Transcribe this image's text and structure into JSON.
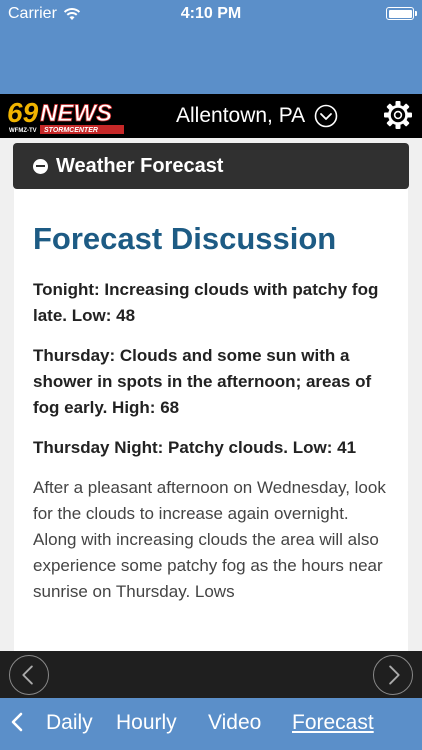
{
  "status_bar": {
    "carrier": "Carrier",
    "time": "4:10 PM"
  },
  "header": {
    "logo_text": "69NEWS",
    "logo_subtext": "WFMZ-TV STORMCENTER",
    "location": "Allentown, PA"
  },
  "section": {
    "title": "Weather Forecast"
  },
  "discussion": {
    "heading": "Forecast Discussion",
    "tonight": "Tonight: Increasing clouds with patchy fog late. Low: 48",
    "thursday": "Thursday: Clouds and some sun with a shower in spots in the afternoon; areas of fog early. High: 68",
    "thursday_night": "Thursday Night: Patchy clouds. Low: 41",
    "body": "After a pleasant afternoon on Wednesday, look for the clouds to increase again overnight. Along with increasing clouds the area will also experience some patchy fog as the hours near sunrise on Thursday. Lows"
  },
  "tabs": {
    "daily": "Daily",
    "hourly": "Hourly",
    "video": "Video",
    "forecast": "Forecast"
  },
  "colors": {
    "bar_blue": "#5b8fc9",
    "heading_blue": "#1d5b84"
  }
}
